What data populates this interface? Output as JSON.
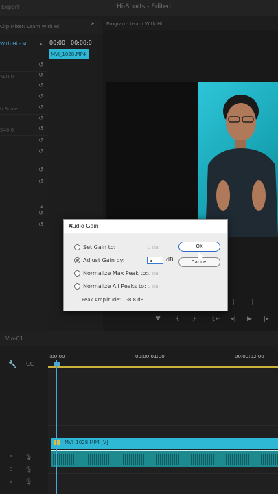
{
  "topbar": {
    "export": "Export",
    "title": "Hi-Shorts - Edited"
  },
  "left_panel": {
    "tab": "Clip Mixer: Learn With Hi",
    "clip_label": "With Hi - M...",
    "rows": [
      "",
      "540.0",
      "",
      "h Scale",
      "540.0",
      "",
      "",
      "",
      ""
    ]
  },
  "source_timeline": {
    "tc1": "00:00",
    "tc2": "00:00:0",
    "clip": "MVI_1028.MP4"
  },
  "program": {
    "title": "Program: Learn With Hi"
  },
  "dialog": {
    "title": "Audio Gain",
    "options": [
      {
        "label": "Set Gain to:",
        "value": "0 dB",
        "selected": false
      },
      {
        "label": "Adjust Gain by:",
        "value": "",
        "selected": true
      },
      {
        "label": "Normalize Max Peak to:",
        "value": "0 dB",
        "selected": false
      },
      {
        "label": "Normalize All Peaks to:",
        "value": "0 dB",
        "selected": false
      }
    ],
    "gain_value": "3",
    "gain_unit": "dB",
    "ok": "OK",
    "cancel": "Cancel",
    "peak_label": "Peak Amplitude:",
    "peak_value": "-8.8 dB"
  },
  "timeline": {
    "sequence": "Vlo-01",
    "ruler": [
      ":00:00",
      "00:00:01:00",
      "00:00:02:00"
    ],
    "video_clip": "MVI_1028.MP4 [V]"
  }
}
